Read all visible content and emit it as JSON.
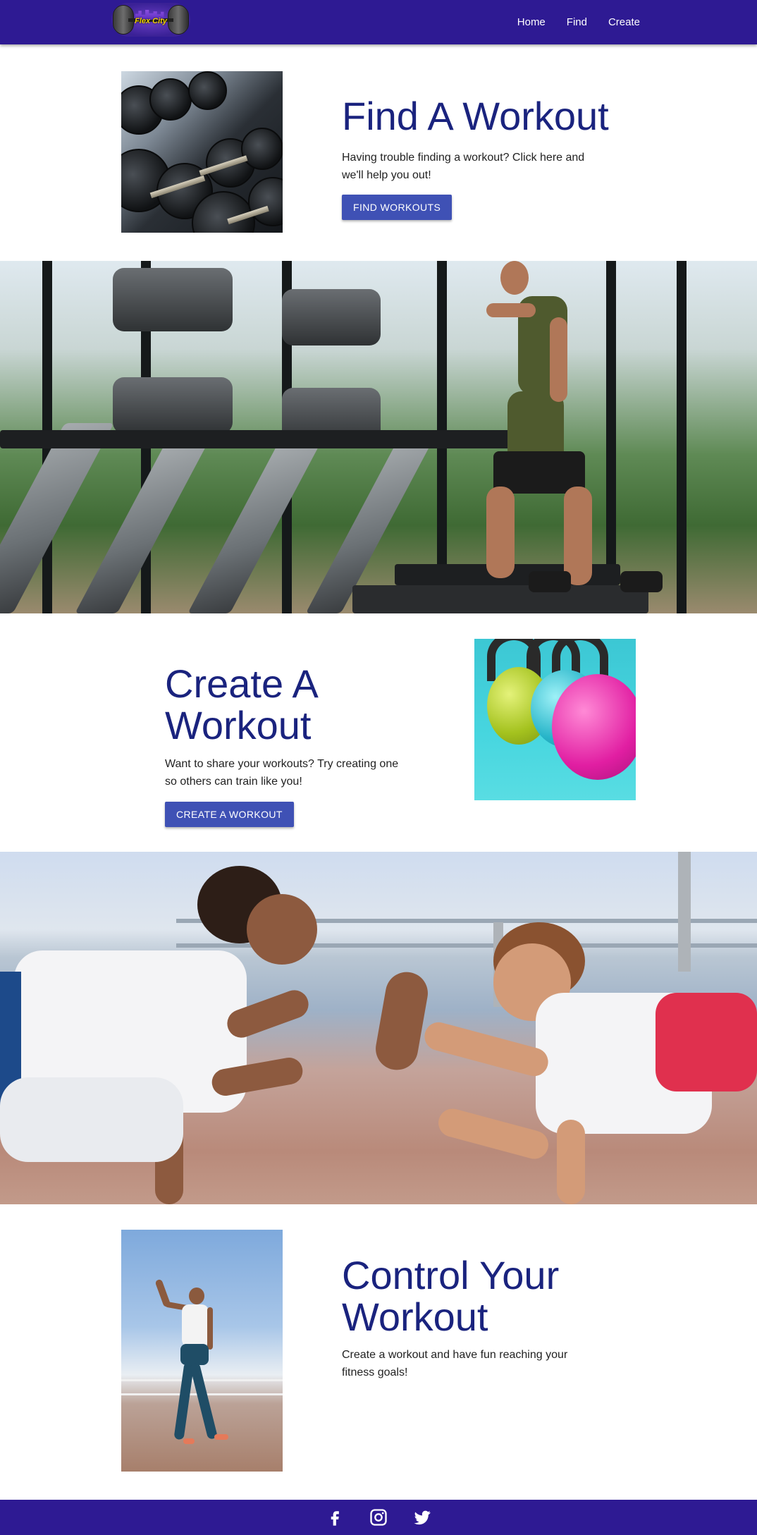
{
  "navbar": {
    "logo_text": "Flex City",
    "links": [
      {
        "label": "Home"
      },
      {
        "label": "Find"
      },
      {
        "label": "Create"
      }
    ]
  },
  "find_section": {
    "title": "Find A Workout",
    "text": "Having trouble finding a workout? Click here and we'll help you out!",
    "button_label": "FIND WORKOUTS"
  },
  "create_section": {
    "title": "Create A Workout",
    "text": "Want to share your workouts? Try creating one so others can train like you!",
    "button_label": "CREATE A WORKOUT"
  },
  "control_section": {
    "title": "Control Your Workout",
    "text": "Create a workout and have fun reaching your fitness goals!"
  },
  "footer": {
    "icons": [
      "facebook-icon",
      "instagram-icon",
      "twitter-icon"
    ]
  },
  "colors": {
    "navbar": "#2e1a93",
    "heading": "#1a237e",
    "button": "#3f51b5",
    "footer": "#2e1a93"
  }
}
